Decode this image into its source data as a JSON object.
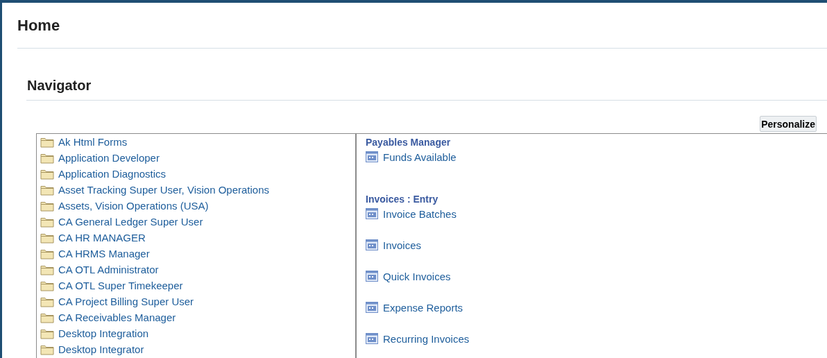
{
  "page": {
    "title": "Home"
  },
  "navigator": {
    "title": "Navigator",
    "personalize_button": "Personalize",
    "responsibilities": [
      {
        "label": "Ak Html Forms"
      },
      {
        "label": "Application Developer"
      },
      {
        "label": "Application Diagnostics"
      },
      {
        "label": "Asset Tracking Super User, Vision Operations"
      },
      {
        "label": "Assets, Vision Operations (USA)"
      },
      {
        "label": "CA General Ledger Super User"
      },
      {
        "label": "CA HR MANAGER"
      },
      {
        "label": "CA HRMS Manager"
      },
      {
        "label": "CA OTL Administrator"
      },
      {
        "label": "CA OTL Super Timekeeper"
      },
      {
        "label": "CA Project Billing Super User"
      },
      {
        "label": "CA Receivables Manager"
      },
      {
        "label": "Desktop Integration"
      },
      {
        "label": "Desktop Integrator"
      }
    ],
    "sections": [
      {
        "heading": "Payables Manager",
        "links": [
          "Funds Available"
        ]
      },
      {
        "heading": "Invoices : Entry",
        "links": [
          "Invoice Batches",
          "Invoices",
          "Quick Invoices",
          "Expense Reports",
          "Recurring Invoices"
        ]
      }
    ]
  }
}
